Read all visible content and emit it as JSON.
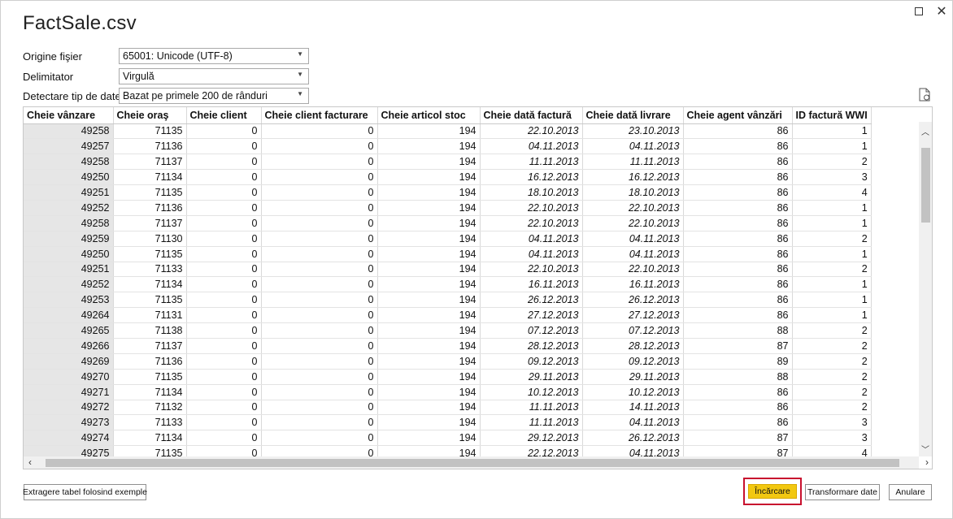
{
  "window": {
    "title": "FactSale.csv"
  },
  "options": {
    "file_origin": {
      "label": "Origine fişier",
      "value": "65001: Unicode (UTF-8)"
    },
    "delimiter": {
      "label": "Delimitator",
      "value": "Virgulă"
    },
    "type_detection": {
      "label": "Detectare tip de date",
      "value": "Bazat pe primele 200 de rânduri"
    }
  },
  "table": {
    "columns": [
      "Cheie vânzare",
      "Cheie oraş",
      "Cheie client",
      "Cheie client facturare",
      "Cheie articol stoc",
      "Cheie dată factură",
      "Cheie dată livrare",
      "Cheie agent vânzări",
      "ID factură WWI"
    ],
    "rows": [
      [
        "49258",
        "71135",
        "0",
        "0",
        "194",
        "22.10.2013",
        "23.10.2013",
        "86",
        "1"
      ],
      [
        "49257",
        "71136",
        "0",
        "0",
        "194",
        "04.11.2013",
        "04.11.2013",
        "86",
        "1"
      ],
      [
        "49258",
        "71137",
        "0",
        "0",
        "194",
        "11.11.2013",
        "11.11.2013",
        "86",
        "2"
      ],
      [
        "49250",
        "71134",
        "0",
        "0",
        "194",
        "16.12.2013",
        "16.12.2013",
        "86",
        "3"
      ],
      [
        "49251",
        "71135",
        "0",
        "0",
        "194",
        "18.10.2013",
        "18.10.2013",
        "86",
        "4"
      ],
      [
        "49252",
        "71136",
        "0",
        "0",
        "194",
        "22.10.2013",
        "22.10.2013",
        "86",
        "1"
      ],
      [
        "49258",
        "71137",
        "0",
        "0",
        "194",
        "22.10.2013",
        "22.10.2013",
        "86",
        "1"
      ],
      [
        "49259",
        "71130",
        "0",
        "0",
        "194",
        "04.11.2013",
        "04.11.2013",
        "86",
        "2"
      ],
      [
        "49250",
        "71135",
        "0",
        "0",
        "194",
        "04.11.2013",
        "04.11.2013",
        "86",
        "1"
      ],
      [
        "49251",
        "71133",
        "0",
        "0",
        "194",
        "22.10.2013",
        "22.10.2013",
        "86",
        "2"
      ],
      [
        "49252",
        "71134",
        "0",
        "0",
        "194",
        "16.11.2013",
        "16.11.2013",
        "86",
        "1"
      ],
      [
        "49253",
        "71135",
        "0",
        "0",
        "194",
        "26.12.2013",
        "26.12.2013",
        "86",
        "1"
      ],
      [
        "49264",
        "71131",
        "0",
        "0",
        "194",
        "27.12.2013",
        "27.12.2013",
        "86",
        "1"
      ],
      [
        "49265",
        "71138",
        "0",
        "0",
        "194",
        "07.12.2013",
        "07.12.2013",
        "88",
        "2"
      ],
      [
        "49266",
        "71137",
        "0",
        "0",
        "194",
        "28.12.2013",
        "28.12.2013",
        "87",
        "2"
      ],
      [
        "49269",
        "71136",
        "0",
        "0",
        "194",
        "09.12.2013",
        "09.12.2013",
        "89",
        "2"
      ],
      [
        "49270",
        "71135",
        "0",
        "0",
        "194",
        "29.11.2013",
        "29.11.2013",
        "88",
        "2"
      ],
      [
        "49271",
        "71134",
        "0",
        "0",
        "194",
        "10.12.2013",
        "10.12.2013",
        "86",
        "2"
      ],
      [
        "49272",
        "71132",
        "0",
        "0",
        "194",
        "11.11.2013",
        "14.11.2013",
        "86",
        "2"
      ],
      [
        "49273",
        "71133",
        "0",
        "0",
        "194",
        "11.11.2013",
        "04.11.2013",
        "86",
        "3"
      ],
      [
        "49274",
        "71134",
        "0",
        "0",
        "194",
        "29.12.2013",
        "26.12.2013",
        "87",
        "3"
      ],
      [
        "49275",
        "71135",
        "0",
        "0",
        "194",
        "22.12.2013",
        "04.11.2013",
        "87",
        "4"
      ]
    ]
  },
  "buttons": {
    "extract": "Extragere tabel folosind exemple",
    "load": "Încărcare",
    "transform": "Transformare date",
    "cancel": "Anulare"
  },
  "colors": {
    "load_button": "#f2c811",
    "highlight_frame": "#c8102e"
  },
  "icons": [
    "maximize-icon",
    "close-icon",
    "refresh-preview-icon",
    "chevron-down-icon",
    "scroll-up-icon",
    "scroll-down-icon",
    "scroll-left-icon",
    "scroll-right-icon"
  ]
}
